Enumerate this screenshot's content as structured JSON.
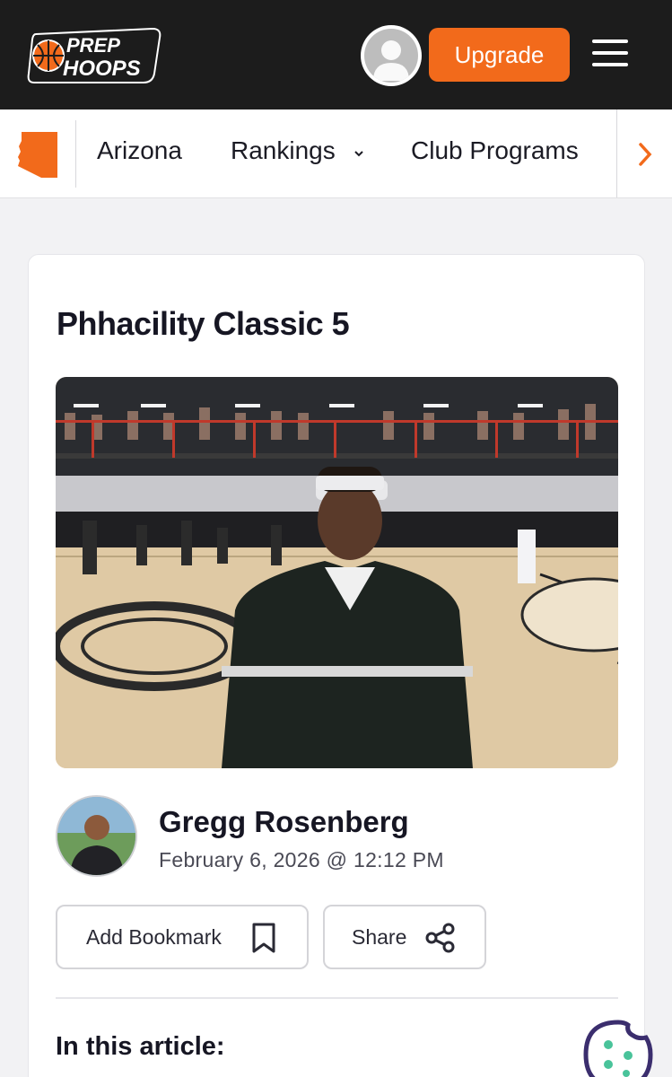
{
  "header": {
    "logo_line1": "PREP",
    "logo_line2": "HOOPS",
    "upgrade_label": "Upgrade",
    "brand_color": "#f26a1b",
    "bg_color": "#1c1c1c"
  },
  "subnav": {
    "state_icon": "arizona-state-shape",
    "items": [
      {
        "label": "Arizona"
      },
      {
        "label": "Rankings",
        "has_dropdown": true
      },
      {
        "label": "Club Programs"
      }
    ],
    "next_icon": "chevron-right-icon"
  },
  "article": {
    "title": "Phhacility Classic 5",
    "author": {
      "name": "Gregg Rosenberg",
      "date": "February 6, 2026 @ 12:12 PM"
    },
    "actions": {
      "bookmark_label": "Add Bookmark",
      "share_label": "Share"
    },
    "toc_heading": "In this article:"
  },
  "icons": {
    "avatar": "user-avatar-icon",
    "menu": "hamburger-menu-icon",
    "bookmark": "bookmark-icon",
    "share": "share-icon",
    "cookie": "cookie-icon"
  }
}
